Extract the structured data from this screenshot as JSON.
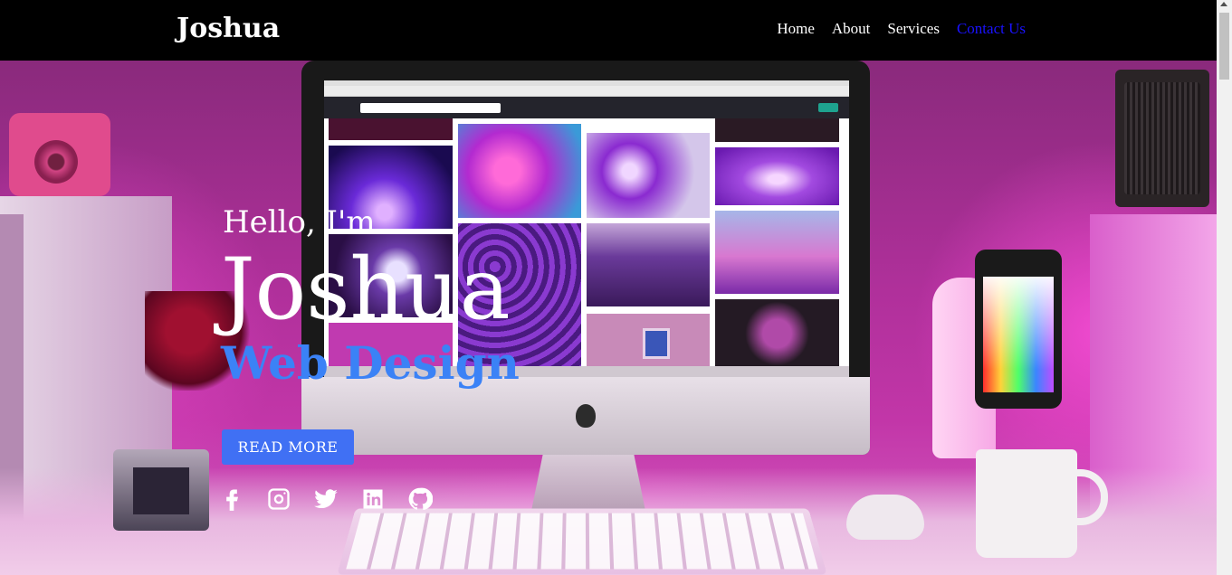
{
  "navbar": {
    "brand": "Joshua",
    "links": [
      {
        "label": "Home"
      },
      {
        "label": "About"
      },
      {
        "label": "Services"
      },
      {
        "label": "Contact Us"
      }
    ]
  },
  "hero": {
    "greeting": "Hello, I'm",
    "name": "Joshua",
    "role": "Web Design",
    "cta_label": "READ MORE",
    "socials": [
      {
        "icon": "facebook-icon"
      },
      {
        "icon": "instagram-icon"
      },
      {
        "icon": "twitter-icon"
      },
      {
        "icon": "linkedin-icon"
      },
      {
        "icon": "github-icon"
      }
    ]
  },
  "colors": {
    "navbar_bg": "#000000",
    "active_link": "#1a12ff",
    "role_text": "#3b82f6",
    "cta_bg": "#4070f4",
    "hero_tint": "#c236a8"
  }
}
